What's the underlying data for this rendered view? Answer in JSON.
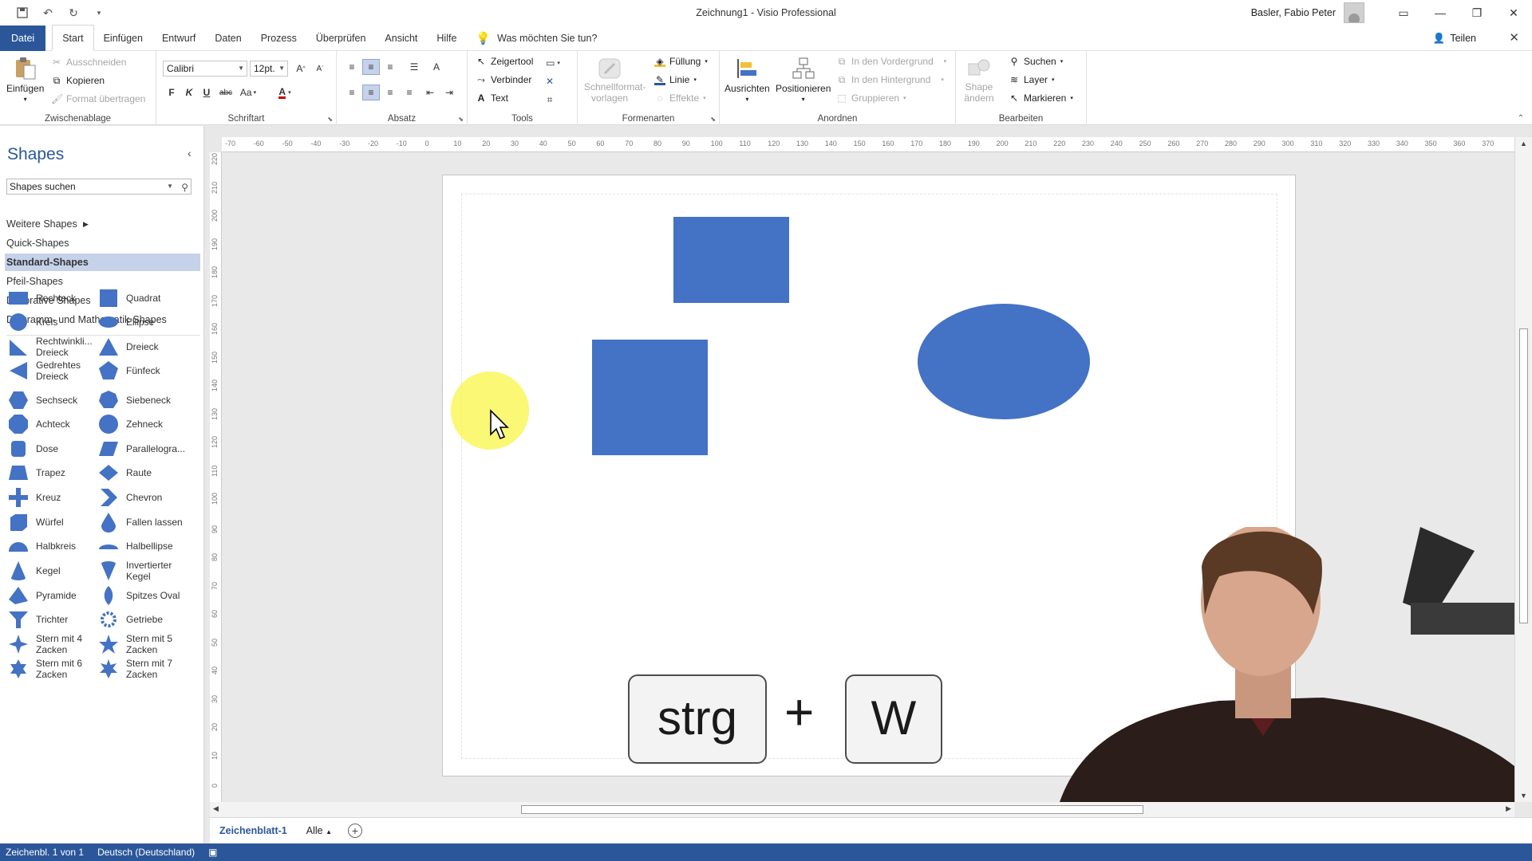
{
  "window": {
    "title": "Zeichnung1  -  Visio Professional",
    "user": "Basler, Fabio Peter"
  },
  "menu": {
    "file": "Datei",
    "tabs": [
      "Start",
      "Einfügen",
      "Entwurf",
      "Daten",
      "Prozess",
      "Überprüfen",
      "Ansicht",
      "Hilfe"
    ],
    "tell_me": "Was möchten Sie tun?",
    "share": "Teilen"
  },
  "ribbon": {
    "clipboard": {
      "label": "Zwischenablage",
      "paste": "Einfügen",
      "cut": "Ausschneiden",
      "copy": "Kopieren",
      "format_painter": "Format übertragen"
    },
    "font": {
      "label": "Schriftart",
      "font_name": "Calibri",
      "font_size": "12pt.",
      "bold": "F",
      "italic": "K",
      "underline": "U",
      "strike": "abc",
      "case": "Aa"
    },
    "paragraph": {
      "label": "Absatz"
    },
    "tools": {
      "label": "Tools",
      "pointer": "Zeigertool",
      "connector": "Verbinder",
      "text": "Text"
    },
    "shape_styles": {
      "label": "Formenarten",
      "quick_styles": "Schnellformat-vorlagen",
      "fill": "Füllung",
      "line": "Linie",
      "effects": "Effekte"
    },
    "arrange": {
      "label": "Anordnen",
      "align": "Ausrichten",
      "position": "Positionieren",
      "bring_front": "In den Vordergrund",
      "send_back": "In den Hintergrund",
      "group": "Gruppieren"
    },
    "editing": {
      "label": "Bearbeiten",
      "change_shape": "Shape ändern",
      "find": "Suchen",
      "layer": "Layer",
      "select": "Markieren"
    }
  },
  "shapes_pane": {
    "title": "Shapes",
    "search_placeholder": "Shapes suchen",
    "stencils": [
      "Weitere Shapes",
      "Quick-Shapes",
      "Standard-Shapes",
      "Pfeil-Shapes",
      "Dekorative Shapes",
      "Diagramm- und Mathematik-Shapes"
    ],
    "selected_stencil": "Standard-Shapes",
    "shapes": [
      [
        "Rechteck",
        "Quadrat"
      ],
      [
        "Kreis",
        "Ellipse"
      ],
      [
        "Rechtwinkli... Dreieck",
        "Dreieck"
      ],
      [
        "Gedrehtes Dreieck",
        "Fünfeck"
      ],
      [
        "Sechseck",
        "Siebeneck"
      ],
      [
        "Achteck",
        "Zehneck"
      ],
      [
        "Dose",
        "Parallelogra..."
      ],
      [
        "Trapez",
        "Raute"
      ],
      [
        "Kreuz",
        "Chevron"
      ],
      [
        "Würfel",
        "Fallen lassen"
      ],
      [
        "Halbkreis",
        "Halbellipse"
      ],
      [
        "Kegel",
        "Invertierter Kegel"
      ],
      [
        "Pyramide",
        "Spitzes Oval"
      ],
      [
        "Trichter",
        "Getriebe"
      ],
      [
        "Stern mit 4 Zacken",
        "Stern mit 5 Zacken"
      ],
      [
        "Stern mit 6 Zacken",
        "Stern mit 7 Zacken"
      ]
    ]
  },
  "ruler": {
    "horizontal": [
      "-70",
      "-60",
      "-50",
      "-40",
      "-30",
      "-20",
      "-10",
      "0",
      "10",
      "20",
      "30",
      "40",
      "50",
      "60",
      "70",
      "80",
      "90",
      "100",
      "110",
      "120",
      "130",
      "140",
      "150",
      "160",
      "170",
      "180",
      "190",
      "200",
      "210",
      "220",
      "230",
      "240",
      "250",
      "260",
      "270",
      "280",
      "290",
      "300",
      "310",
      "320",
      "330",
      "340",
      "350",
      "360",
      "370"
    ],
    "vertical": [
      "220",
      "210",
      "200",
      "190",
      "180",
      "170",
      "160",
      "150",
      "140",
      "130",
      "120",
      "110",
      "100",
      "90",
      "80",
      "70",
      "60",
      "50",
      "40",
      "30",
      "20",
      "10",
      "0"
    ]
  },
  "overlay": {
    "key1": "strg",
    "plus": "+",
    "key2": "W"
  },
  "colors": {
    "shape_fill": "#4472c4",
    "accent": "#2b579a",
    "cursor_highlight": "#f8f546"
  },
  "sheets": {
    "current": "Zeichenblatt-1",
    "all": "Alle"
  },
  "status": {
    "page": "Zeichenbl. 1 von 1",
    "language": "Deutsch (Deutschland)"
  }
}
